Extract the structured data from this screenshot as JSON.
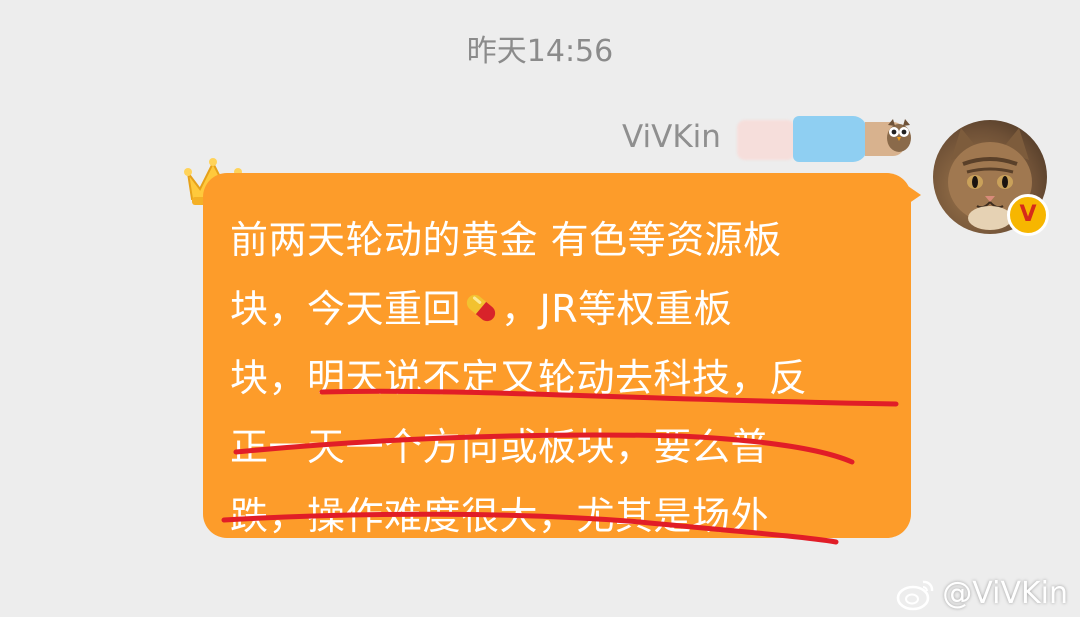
{
  "timestamp": "昨天14:56",
  "sender": {
    "name": "ViVKin",
    "avatar_icon": "cat-avatar",
    "badge_icon": "vip-v-badge",
    "badge_letter": "V"
  },
  "message": {
    "bubble_color": "#fd9c2a",
    "text_color": "#ffffff",
    "decoration_icon": "crown-icon",
    "lines": [
      "前两天轮动的黄金 有色等资源板",
      "块，今天重回",
      "，JR等权重板",
      "块，明天说不定又轮动去科技，反",
      "正一天一个方向或板块，要么普",
      "跌，操作难度很大，尤其是场外"
    ],
    "inline_icon": "pill-icon",
    "underline_color": "#e11d27"
  },
  "watermark": {
    "logo_icon": "weibo-logo",
    "text": "@ViVKin"
  }
}
